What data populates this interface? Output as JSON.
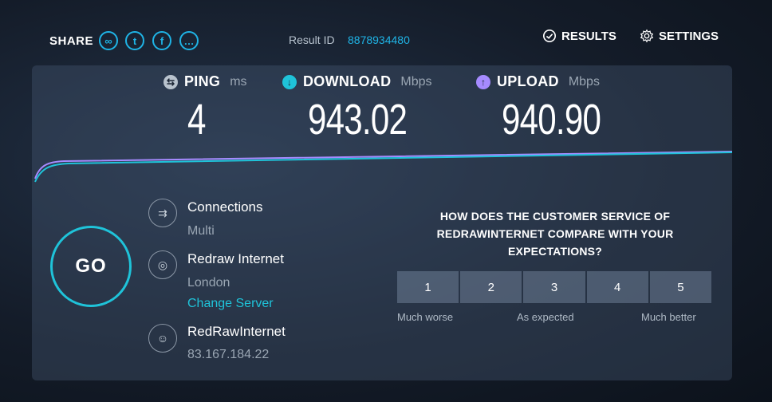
{
  "header": {
    "share_label": "SHARE",
    "share_icons": [
      "link-icon",
      "twitter-icon",
      "facebook-icon",
      "more-icon"
    ],
    "result_label": "Result ID",
    "result_id": "8878934480",
    "results_label": "RESULTS",
    "settings_label": "SETTINGS"
  },
  "metrics": {
    "ping": {
      "name": "PING",
      "unit": "ms",
      "value": "4",
      "icon": "ping-icon"
    },
    "download": {
      "name": "DOWNLOAD",
      "unit": "Mbps",
      "value": "943.02",
      "icon": "download-icon"
    },
    "upload": {
      "name": "UPLOAD",
      "unit": "Mbps",
      "value": "940.90",
      "icon": "upload-icon"
    }
  },
  "colors": {
    "accent": "#1fb4e6",
    "download": "#1fc3d9",
    "upload": "#a68bff",
    "panel": "#3a4a5e"
  },
  "go_label": "GO",
  "connections": {
    "title": "Connections",
    "value": "Multi"
  },
  "server": {
    "title": "Redraw Internet",
    "location": "London",
    "change_label": "Change Server"
  },
  "provider": {
    "name": "RedRawInternet",
    "ip": "83.167.184.22"
  },
  "survey": {
    "question": "HOW DOES THE CUSTOMER SERVICE OF REDRAWINTERNET COMPARE WITH YOUR EXPECTATIONS?",
    "options": [
      "1",
      "2",
      "3",
      "4",
      "5"
    ],
    "labels": {
      "low": "Much worse",
      "mid": "As expected",
      "high": "Much better"
    }
  }
}
